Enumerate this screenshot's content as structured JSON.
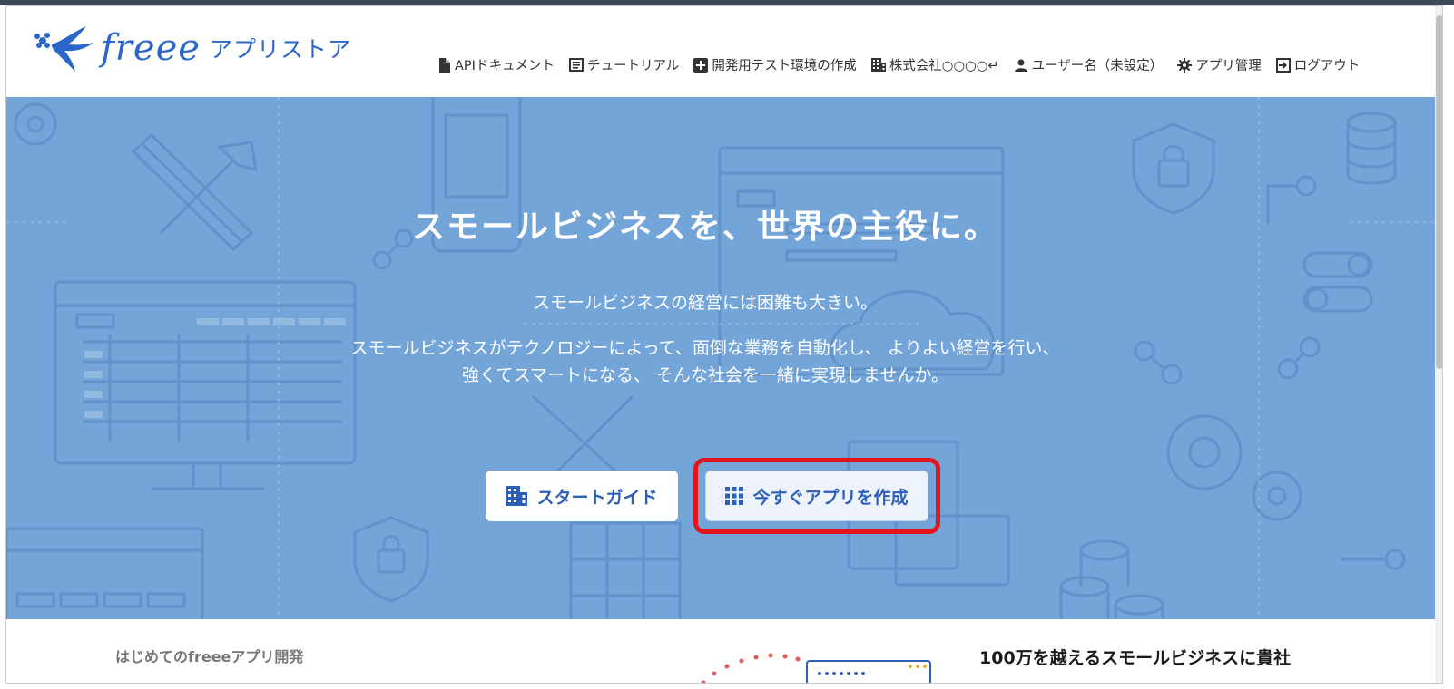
{
  "brand": {
    "wordmark": "freee",
    "store_label": "アプリストア",
    "color": "#2b67c9"
  },
  "nav": [
    {
      "icon": "document-icon",
      "label": "APIドキュメント"
    },
    {
      "icon": "book-icon",
      "label": "チュートリアル"
    },
    {
      "icon": "plus-square-icon",
      "label": "開発用テスト環境の作成"
    },
    {
      "icon": "building-icon",
      "label": "株式会社○○○○↵"
    },
    {
      "icon": "user-icon",
      "label": "ユーザー名（未設定）"
    },
    {
      "icon": "gear-icon",
      "label": "アプリ管理"
    },
    {
      "icon": "logout-icon",
      "label": "ログアウト"
    }
  ],
  "hero": {
    "title": "スモールビジネスを、世界の主役に。",
    "subtitle_1": "スモールビジネスの経営には困難も大きい。",
    "subtitle_2": "スモールビジネスがテクノロジーによって、面倒な業務を自動化し、 よりよい経営を行い、",
    "subtitle_3": "強くてスマートになる、 そんな社会を一緒に実現しませんか。",
    "background_color": "#74a5d9",
    "buttons": {
      "guide": {
        "label": "スタートガイド",
        "icon": "building-icon"
      },
      "create": {
        "label": "今すぐアプリを作成",
        "icon": "grid-icon"
      }
    },
    "highlight_color": "#e8141b"
  },
  "below": {
    "left_heading": "はじめてのfreeeアプリ開発",
    "right_heading": "100万を越えるスモールビジネスに貴社"
  }
}
